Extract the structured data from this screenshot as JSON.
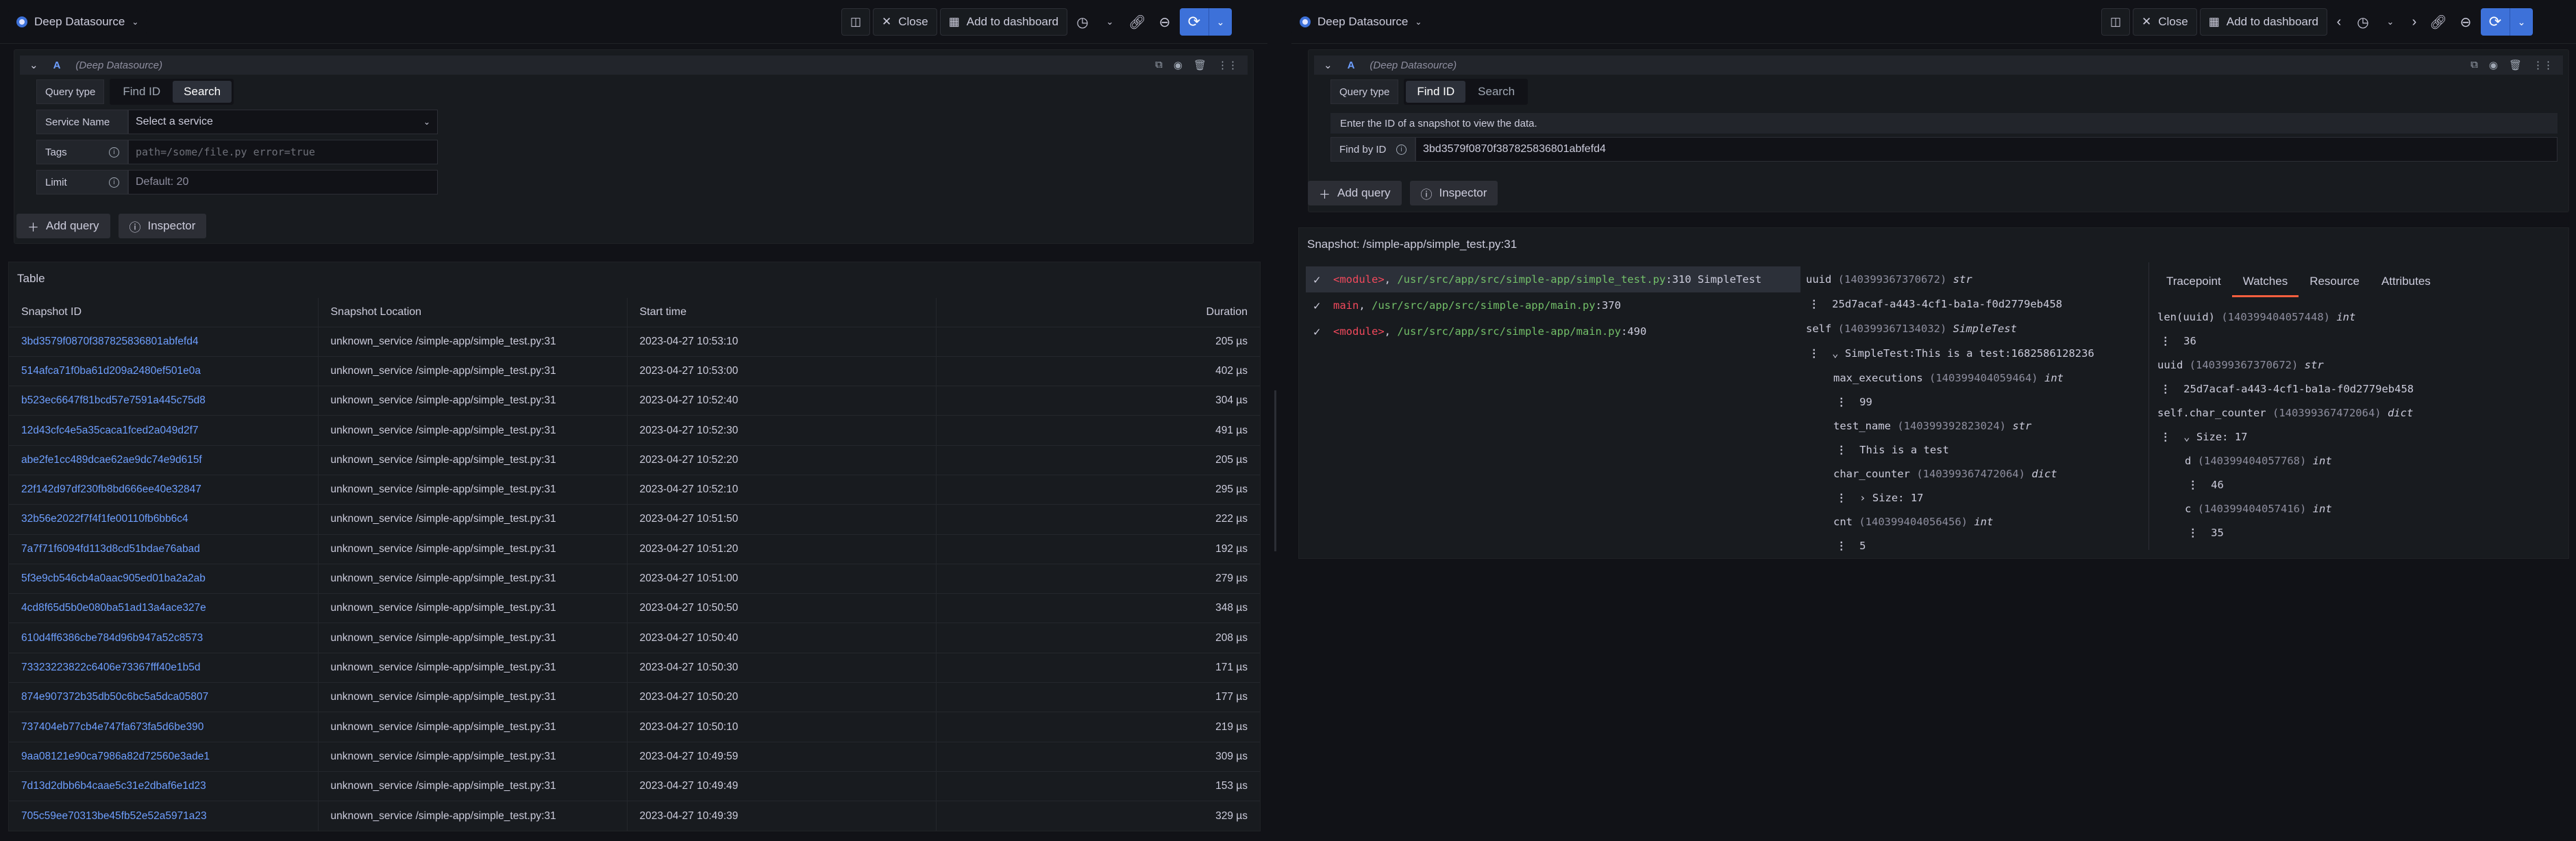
{
  "left": {
    "datasource": "Deep Datasource",
    "toolbar": {
      "close": "Close",
      "add_dashboard": "Add to dashboard"
    },
    "query": {
      "letter": "A",
      "ds": "(Deep Datasource)",
      "query_type_label": "Query type",
      "tabs": [
        "Find ID",
        "Search"
      ],
      "active_tab": "Search",
      "service_label": "Service Name",
      "service_placeholder": "Select a service",
      "tags_label": "Tags",
      "tags_placeholder": "path=/some/file.py error=true",
      "limit_label": "Limit",
      "limit_placeholder": "Default: 20"
    },
    "add_query": "Add query",
    "inspector": "Inspector",
    "table": {
      "title": "Table",
      "columns": [
        "Snapshot ID",
        "Snapshot Location",
        "Start time",
        "Duration"
      ],
      "rows": [
        [
          "3bd3579f0870f387825836801abfefd4",
          "unknown_service /simple-app/simple_test.py:31",
          "2023-04-27 10:53:10",
          "205 µs"
        ],
        [
          "514afca71f0ba61d209a2480ef501e0a",
          "unknown_service /simple-app/simple_test.py:31",
          "2023-04-27 10:53:00",
          "402 µs"
        ],
        [
          "b523ec6647f81bcd57e7591a445c75d8",
          "unknown_service /simple-app/simple_test.py:31",
          "2023-04-27 10:52:40",
          "304 µs"
        ],
        [
          "12d43cfc4e5a35caca1fced2a049d2f7",
          "unknown_service /simple-app/simple_test.py:31",
          "2023-04-27 10:52:30",
          "491 µs"
        ],
        [
          "abe2fe1cc489dcae62ae9dc74e9d615f",
          "unknown_service /simple-app/simple_test.py:31",
          "2023-04-27 10:52:20",
          "205 µs"
        ],
        [
          "22f142d97df230fb8bd666ee40e32847",
          "unknown_service /simple-app/simple_test.py:31",
          "2023-04-27 10:52:10",
          "295 µs"
        ],
        [
          "32b56e2022f7f4f1fe00110fb6bb6c4",
          "unknown_service /simple-app/simple_test.py:31",
          "2023-04-27 10:51:50",
          "222 µs"
        ],
        [
          "7a7f71f6094fd113d8cd51bdae76abad",
          "unknown_service /simple-app/simple_test.py:31",
          "2023-04-27 10:51:20",
          "192 µs"
        ],
        [
          "5f3e9cb546cb4a0aac905ed01ba2a2ab",
          "unknown_service /simple-app/simple_test.py:31",
          "2023-04-27 10:51:00",
          "279 µs"
        ],
        [
          "4cd8f65d5b0e080ba51ad13a4ace327e",
          "unknown_service /simple-app/simple_test.py:31",
          "2023-04-27 10:50:50",
          "348 µs"
        ],
        [
          "610d4ff6386cbe784d96b947a52c8573",
          "unknown_service /simple-app/simple_test.py:31",
          "2023-04-27 10:50:40",
          "208 µs"
        ],
        [
          "73323223822c6406e73367fff40e1b5d",
          "unknown_service /simple-app/simple_test.py:31",
          "2023-04-27 10:50:30",
          "171 µs"
        ],
        [
          "874e907372b35db50c6bc5a5dca05807",
          "unknown_service /simple-app/simple_test.py:31",
          "2023-04-27 10:50:20",
          "177 µs"
        ],
        [
          "737404eb77cb4e747fa673fa5d6be390",
          "unknown_service /simple-app/simple_test.py:31",
          "2023-04-27 10:50:10",
          "219 µs"
        ],
        [
          "9aa08121e90ca7986a82d72560e3ade1",
          "unknown_service /simple-app/simple_test.py:31",
          "2023-04-27 10:49:59",
          "309 µs"
        ],
        [
          "7d13d2dbb6b4caae5c31e2dbaf6e1d23",
          "unknown_service /simple-app/simple_test.py:31",
          "2023-04-27 10:49:49",
          "153 µs"
        ],
        [
          "705c59ee70313be45fb52e52a5971a23",
          "unknown_service /simple-app/simple_test.py:31",
          "2023-04-27 10:49:39",
          "329 µs"
        ]
      ]
    }
  },
  "right": {
    "datasource": "Deep Datasource",
    "toolbar": {
      "close": "Close",
      "add_dashboard": "Add to dashboard"
    },
    "query": {
      "letter": "A",
      "ds": "(Deep Datasource)",
      "query_type_label": "Query type",
      "tabs": [
        "Find ID",
        "Search"
      ],
      "active_tab": "Find ID",
      "info": "Enter the ID of a snapshot to view the data.",
      "find_label": "Find by ID",
      "find_value": "3bd3579f0870f387825836801abfefd4"
    },
    "add_query": "Add query",
    "inspector": "Inspector",
    "snapshot": {
      "title": "Snapshot: /simple-app/simple_test.py:31",
      "frames": [
        {
          "fn": "<module>",
          "sep": ", ",
          "path": "/usr/src/app/src/simple-app/simple_test.py",
          "line": ":310",
          "extra": " SimpleTest"
        },
        {
          "fn": "main",
          "sep": ", ",
          "path": "/usr/src/app/src/simple-app/main.py",
          "line": ":370",
          "extra": ""
        },
        {
          "fn": "<module>",
          "sep": ", ",
          "path": "/usr/src/app/src/simple-app/main.py",
          "line": ":490",
          "extra": ""
        }
      ],
      "vars": {
        "uuid_name": "uuid",
        "uuid_addr": "(140399367370672)",
        "uuid_type": "str",
        "uuid_val": "25d7acaf-a443-4cf1-ba1a-f0d2779eb458",
        "self_name": "self",
        "self_addr": "(140399367134032)",
        "self_type": "SimpleTest",
        "self_val": "SimpleTest:This is a test:1682586128236",
        "maxexec_name": "max_executions",
        "maxexec_addr": "(140399404059464)",
        "maxexec_type": "int",
        "maxexec_val": "99",
        "tname_name": "test_name",
        "tname_addr": "(140399392823024)",
        "tname_type": "str",
        "tname_val": "This is a test",
        "cc_name": "char_counter",
        "cc_addr": "(140399367472064)",
        "cc_type": "dict",
        "cc_val": "Size: 17",
        "cnt_name": "cnt",
        "cnt_addr": "(140399404056456)",
        "cnt_type": "int",
        "cnt_val": "5"
      },
      "tabs": [
        "Tracepoint",
        "Watches",
        "Resource",
        "Attributes"
      ],
      "active_tab": "Watches",
      "watches": {
        "w1_name": "len(uuid)",
        "w1_addr": "(140399404057448)",
        "w1_type": "int",
        "w1_val": "36",
        "w2_name": "uuid",
        "w2_addr": "(140399367370672)",
        "w2_type": "str",
        "w2_val": "25d7acaf-a443-4cf1-ba1a-f0d2779eb458",
        "w3_name": "self.char_counter",
        "w3_addr": "(140399367472064)",
        "w3_type": "dict",
        "w3_val": "Size: 17",
        "d_name": "d",
        "d_addr": "(140399404057768)",
        "d_type": "int",
        "d_val": "46",
        "c_name": "c",
        "c_addr": "(140399404057416)",
        "c_type": "int",
        "c_val": "35"
      }
    }
  },
  "icons": {
    "accent": "#3d71d9",
    "link": "#6e9fff",
    "error": "#f2495c",
    "path": "#73bf69"
  }
}
